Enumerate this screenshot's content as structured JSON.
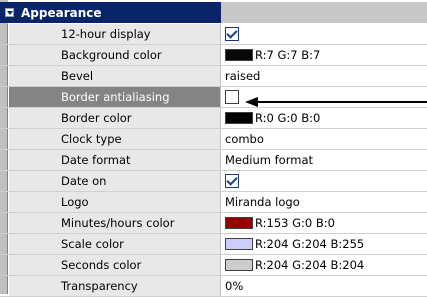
{
  "group": {
    "title": "Appearance"
  },
  "rows": [
    {
      "name": "12-hour display",
      "kind": "checkbox",
      "checked": true,
      "value": ""
    },
    {
      "name": "Background color",
      "kind": "color",
      "color": "#070707",
      "value": "R:7 G:7 B:7"
    },
    {
      "name": "Bevel",
      "kind": "text",
      "value": "raised"
    },
    {
      "name": "Border antialiasing",
      "kind": "checkbox",
      "checked": false,
      "selected": true,
      "value": ""
    },
    {
      "name": "Border color",
      "kind": "color",
      "color": "#000000",
      "value": "R:0 G:0 B:0"
    },
    {
      "name": "Clock type",
      "kind": "text",
      "value": "combo"
    },
    {
      "name": "Date format",
      "kind": "text",
      "value": "Medium format"
    },
    {
      "name": "Date on",
      "kind": "checkbox",
      "checked": true,
      "value": ""
    },
    {
      "name": "Logo",
      "kind": "text",
      "value": "Miranda logo"
    },
    {
      "name": "Minutes/hours color",
      "kind": "color",
      "color": "#990000",
      "value": "R:153 G:0 B:0"
    },
    {
      "name": "Scale color",
      "kind": "color",
      "color": "#ccccff",
      "value": "R:204 G:204 B:255"
    },
    {
      "name": "Seconds color",
      "kind": "color",
      "color": "#cccccc",
      "value": "R:204 G:204 B:204"
    },
    {
      "name": "Transparency",
      "kind": "text",
      "value": "0%"
    }
  ],
  "colors": {
    "header_bg": "#0a246a",
    "selected_bg": "#848484",
    "name_cell_bg": "#e8e8e8"
  },
  "annotation": {
    "icon": "left-arrow-pointer"
  }
}
